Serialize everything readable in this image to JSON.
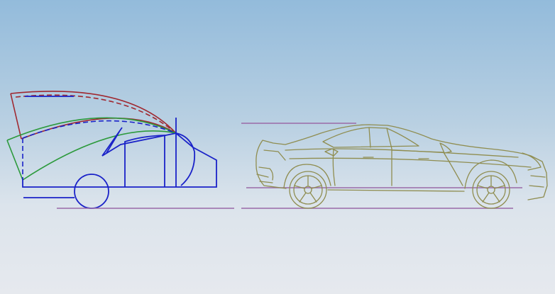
{
  "scene": {
    "name": "cad-viewport",
    "background": {
      "top": "#93bbdb",
      "bottom": "#e6e9ee"
    }
  },
  "colors": {
    "mechanism_blue": "#1a22c8",
    "arc_red": "#a02830",
    "arc_green": "#2c9a3c",
    "reference_line": "#9a6aa8",
    "car_outline": "#8f8d50"
  }
}
